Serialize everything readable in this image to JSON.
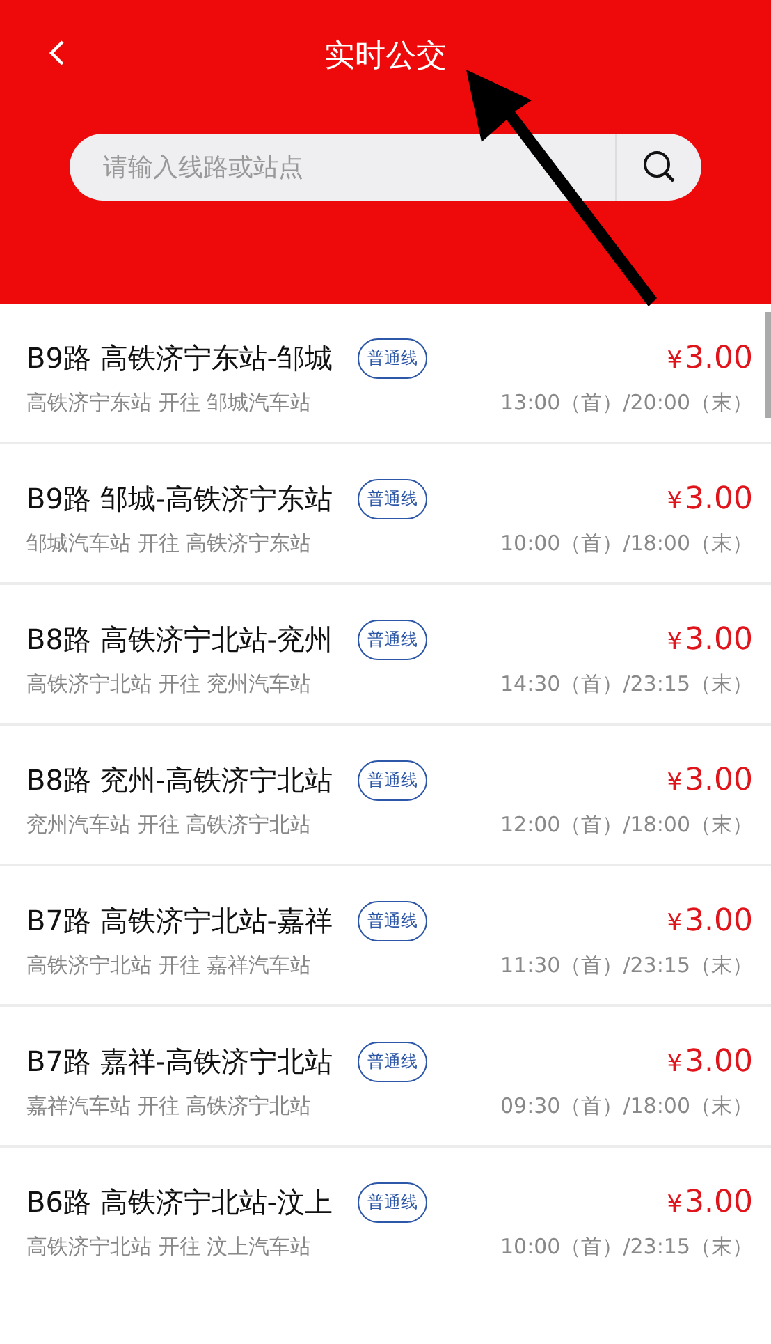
{
  "header": {
    "title": "实时公交",
    "search": {
      "placeholder": "请输入线路或站点"
    }
  },
  "routes": [
    {
      "name": "B9路 高铁济宁东站-邹城",
      "tag": "普通线",
      "currency": "¥",
      "price": "3.00",
      "direction": "高铁济宁东站 开往 邹城汽车站",
      "hours": "13:00（首）/20:00（末）"
    },
    {
      "name": "B9路 邹城-高铁济宁东站",
      "tag": "普通线",
      "currency": "¥",
      "price": "3.00",
      "direction": "邹城汽车站 开往 高铁济宁东站",
      "hours": "10:00（首）/18:00（末）"
    },
    {
      "name": "B8路 高铁济宁北站-兖州",
      "tag": "普通线",
      "currency": "¥",
      "price": "3.00",
      "direction": "高铁济宁北站 开往 兖州汽车站",
      "hours": "14:30（首）/23:15（末）"
    },
    {
      "name": "B8路 兖州-高铁济宁北站",
      "tag": "普通线",
      "currency": "¥",
      "price": "3.00",
      "direction": "兖州汽车站 开往 高铁济宁北站",
      "hours": "12:00（首）/18:00（末）"
    },
    {
      "name": "B7路 高铁济宁北站-嘉祥",
      "tag": "普通线",
      "currency": "¥",
      "price": "3.00",
      "direction": "高铁济宁北站 开往 嘉祥汽车站",
      "hours": "11:30（首）/23:15（末）"
    },
    {
      "name": "B7路 嘉祥-高铁济宁北站",
      "tag": "普通线",
      "currency": "¥",
      "price": "3.00",
      "direction": "嘉祥汽车站 开往 高铁济宁北站",
      "hours": "09:30（首）/18:00（末）"
    },
    {
      "name": "B6路 高铁济宁北站-汶上",
      "tag": "普通线",
      "currency": "¥",
      "price": "3.00",
      "direction": "高铁济宁北站 开往 汶上汽车站",
      "hours": "10:00（首）/23:15（末）"
    }
  ]
}
